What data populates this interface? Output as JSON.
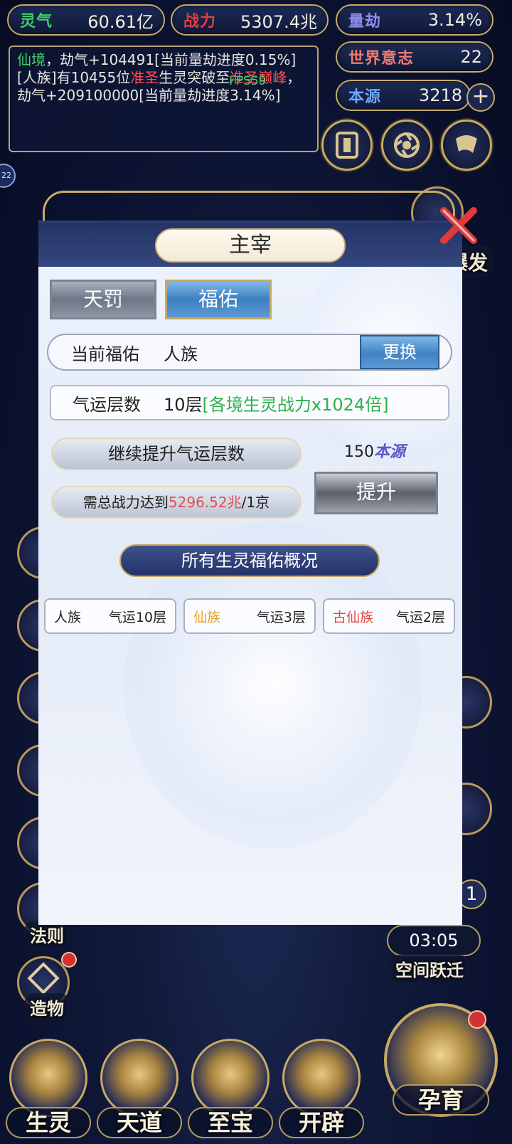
{
  "resources": {
    "lingqi": {
      "label": "灵气",
      "value": "60.61亿",
      "color": "#3ccf63"
    },
    "zhanli": {
      "label": "战力",
      "value": "5307.4兆",
      "color": "#e2403f"
    },
    "liangjie": {
      "label": "量劫",
      "value": "3.14%",
      "color": "#8f8ce8"
    },
    "shijie": {
      "label": "世界意志",
      "value": "22",
      "color": "#ef7a6e"
    },
    "benyuan": {
      "label": "本源",
      "value": "3218",
      "color": "#6fa7ff"
    }
  },
  "log": {
    "line1_a": "仙境",
    "line1_b": "，劫气+104491[当前量劫进度0.15%]",
    "line2_a": "[人族]有10455位",
    "line2_b": "准圣",
    "line2_c": "生灵突破至",
    "line2_d": "准圣巅峰",
    "line2_e": "，劫气+209100000[当前量劫进度3.14%]",
    "fps": "FPS59"
  },
  "side": {
    "right_badge_22": "22",
    "burst": "爆发",
    "law": "法则",
    "creation": "造物",
    "timer": "03:05",
    "space_jump": "空间跃迁"
  },
  "modal": {
    "title": "主宰",
    "tab_punish": "天罚",
    "tab_bless": "福佑",
    "current_label": "当前福佑",
    "current_value": "人族",
    "change_btn": "更换",
    "luck_label": "气运层数",
    "luck_value": "10层",
    "luck_effect": "[各境生灵战力x1024倍]",
    "continue_label": "继续提升气运层数",
    "cost_value": "150",
    "cost_unit": "本源",
    "req_prefix": "需总战力达到",
    "req_value": "5296.52兆",
    "req_suffix": "/1京",
    "promote_btn": "提升",
    "overview_title": "所有生灵福佑概况",
    "races": [
      {
        "name": "人族",
        "luck": "气运10层",
        "color": "#222222"
      },
      {
        "name": "仙族",
        "luck": "气运3层",
        "color": "#e6a21e"
      },
      {
        "name": "古仙族",
        "luck": "气运2层",
        "color": "#e04545"
      }
    ]
  },
  "nav": {
    "creatures": "生灵",
    "heaven": "天道",
    "treasure": "至宝",
    "genesis": "开辟",
    "breed": "孕育"
  }
}
